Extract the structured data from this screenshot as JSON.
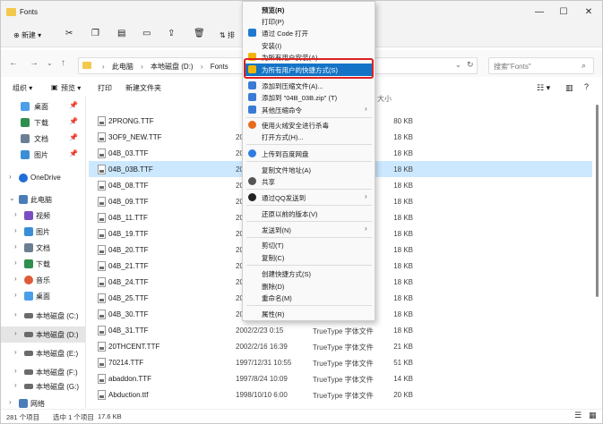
{
  "window": {
    "title": "Fonts",
    "controls": [
      "—",
      "☐",
      "✕"
    ]
  },
  "cmdbar": {
    "new_label": "新建",
    "sort_label": "排",
    "more_label": "..."
  },
  "address": {
    "crumbs": [
      "此电脑",
      "本地磁盘 (D:)",
      "Fonts"
    ],
    "search_placeholder": "搜索\"Fonts\""
  },
  "toolbar2": {
    "organize": "组织 ▾",
    "preview": "预览 ▾",
    "print": "打印",
    "new_folder": "新建文件夹"
  },
  "sidebar": {
    "items": [
      {
        "label": "桌面",
        "color": "#4a9fe8"
      },
      {
        "label": "下载",
        "color": "#2f8f4e"
      },
      {
        "label": "文档",
        "color": "#6a7f94"
      },
      {
        "label": "图片",
        "color": "#3a8ed6"
      },
      {
        "label": "OneDrive",
        "color": "#1e6fd9"
      },
      {
        "label": "此电脑",
        "color": "#4a7db8"
      },
      {
        "label": "视频",
        "color": "#7a4ec2"
      },
      {
        "label": "图片",
        "color": "#3a8ed6"
      },
      {
        "label": "文档",
        "color": "#6a7f94"
      },
      {
        "label": "下载",
        "color": "#2f8f4e"
      },
      {
        "label": "音乐",
        "color": "#e05a3a"
      },
      {
        "label": "桌面",
        "color": "#4a9fe8"
      },
      {
        "label": "本地磁盘 (C:)",
        "color": "#6b6b6b"
      },
      {
        "label": "本地磁盘 (D:)",
        "color": "#6b6b6b"
      },
      {
        "label": "本地磁盘 (E:)",
        "color": "#6b6b6b"
      },
      {
        "label": "本地磁盘 (F:)",
        "color": "#6b6b6b"
      },
      {
        "label": "本地磁盘 (G:)",
        "color": "#6b6b6b"
      },
      {
        "label": "网络",
        "color": "#4a7db8"
      }
    ]
  },
  "files": {
    "size_header": "大小",
    "rows": [
      {
        "name": "2PRONG.TTF",
        "date": "",
        "type": "",
        "size": "80 KB"
      },
      {
        "name": "3OF9_NEW.TTF",
        "date": "20",
        "type": "",
        "size": "18 KB"
      },
      {
        "name": "04B_03.TTF",
        "date": "20",
        "type": "",
        "size": "18 KB"
      },
      {
        "name": "04B_03B.TTF",
        "date": "20",
        "type": "",
        "size": "18 KB"
      },
      {
        "name": "04B_08.TTF",
        "date": "20",
        "type": "",
        "size": "18 KB"
      },
      {
        "name": "04B_09.TTF",
        "date": "20",
        "type": "",
        "size": "18 KB"
      },
      {
        "name": "04B_11.TTF",
        "date": "20",
        "type": "",
        "size": "18 KB"
      },
      {
        "name": "04B_19.TTF",
        "date": "20",
        "type": "",
        "size": "18 KB"
      },
      {
        "name": "04B_20.TTF",
        "date": "20",
        "type": "",
        "size": "18 KB"
      },
      {
        "name": "04B_21.TTF",
        "date": "20",
        "type": "",
        "size": "18 KB"
      },
      {
        "name": "04B_24.TTF",
        "date": "20",
        "type": "",
        "size": "18 KB"
      },
      {
        "name": "04B_25.TTF",
        "date": "20",
        "type": "",
        "size": "18 KB"
      },
      {
        "name": "04B_30.TTF",
        "date": "20",
        "type": "",
        "size": "18 KB"
      },
      {
        "name": "04B_31.TTF",
        "date": "2002/2/23 0:15",
        "type": "TrueType 字体文件",
        "size": "18 KB"
      },
      {
        "name": "20THCENT.TTF",
        "date": "2002/2/16 16:39",
        "type": "TrueType 字体文件",
        "size": "21 KB"
      },
      {
        "name": "70214.TTF",
        "date": "1997/12/31 10:55",
        "type": "TrueType 字体文件",
        "size": "51 KB"
      },
      {
        "name": "abaddon.TTF",
        "date": "1997/8/24 10:09",
        "type": "TrueType 字体文件",
        "size": "14 KB"
      },
      {
        "name": "Abduction.ttf",
        "date": "1998/10/10 6:00",
        "type": "TrueType 字体文件",
        "size": "20 KB"
      }
    ]
  },
  "status": {
    "count": "281 个项目",
    "selected": "选中 1 个项目",
    "size": "17.6 KB"
  },
  "context_menu": {
    "items": [
      {
        "label": "预览(R)",
        "icon": "none",
        "bold": true,
        "sub": false
      },
      {
        "label": "打印(P)",
        "icon": "none",
        "bold": false,
        "sub": false
      },
      {
        "label": "通过 Code 打开",
        "icon": "vscode-icon",
        "color": "#1f7ad1",
        "bold": false,
        "sub": false
      },
      {
        "label": "安装(I)",
        "icon": "none",
        "bold": false,
        "sub": false
      },
      {
        "label": "为所有用户安装(A)",
        "icon": "shield-icon",
        "color": "#f2b400",
        "bold": false,
        "sub": false
      },
      {
        "label": "为所有用户的快捷方式(S)",
        "icon": "shield-icon",
        "color": "#f2b400",
        "bold": false,
        "sub": false,
        "highlight": true
      },
      {
        "label": "添加到压缩文件(A)...",
        "icon": "archive-icon",
        "color": "#3a7bd5",
        "bold": false,
        "sub": false
      },
      {
        "label": "添加到 \"04B_03B.zip\" (T)",
        "icon": "archive-icon",
        "color": "#3a7bd5",
        "bold": false,
        "sub": false
      },
      {
        "label": "其他压缩命令",
        "icon": "archive-icon",
        "color": "#3a7bd5",
        "bold": false,
        "sub": true
      },
      {
        "label": "使用火绒安全进行杀毒",
        "icon": "huorong-icon",
        "color": "#e86a1a",
        "bold": false,
        "sub": false
      },
      {
        "label": "打开方式(H)...",
        "icon": "none",
        "bold": false,
        "sub": false
      },
      {
        "label": "上传到百度网盘",
        "icon": "baidu-cloud-icon",
        "color": "#2f7de1",
        "bold": false,
        "sub": false
      },
      {
        "label": "复制文件地址(A)",
        "icon": "none",
        "bold": false,
        "sub": false
      },
      {
        "label": "共享",
        "icon": "share-icon",
        "color": "#555555",
        "bold": false,
        "sub": false
      },
      {
        "label": "通过QQ发送到",
        "icon": "qq-icon",
        "color": "#222222",
        "bold": false,
        "sub": true
      },
      {
        "label": "还原以前的版本(V)",
        "icon": "none",
        "bold": false,
        "sub": false
      },
      {
        "label": "发送到(N)",
        "icon": "none",
        "bold": false,
        "sub": true
      },
      {
        "label": "剪切(T)",
        "icon": "none",
        "bold": false,
        "sub": false
      },
      {
        "label": "复制(C)",
        "icon": "none",
        "bold": false,
        "sub": false
      },
      {
        "label": "创建快捷方式(S)",
        "icon": "none",
        "bold": false,
        "sub": false
      },
      {
        "label": "删除(D)",
        "icon": "none",
        "bold": false,
        "sub": false
      },
      {
        "label": "重命名(M)",
        "icon": "none",
        "bold": false,
        "sub": false
      },
      {
        "label": "属性(R)",
        "icon": "none",
        "bold": false,
        "sub": false
      }
    ]
  }
}
